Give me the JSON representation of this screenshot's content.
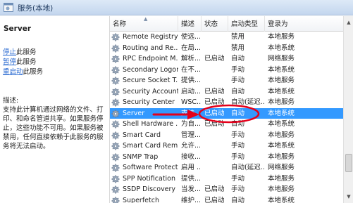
{
  "window": {
    "title": "服务(本地)"
  },
  "left_panel": {
    "heading": "Server",
    "actions": [
      {
        "link": "停止",
        "suffix": "此服务"
      },
      {
        "link": "暂停",
        "suffix": "此服务"
      },
      {
        "link": "重启动",
        "suffix": "此服务"
      }
    ],
    "description_label": "描述:",
    "description": "支持此计算机通过网络的文件、打印、和命名管道共享。如果服务停止，这些功能不可用。如果服务被禁用，任何直接依赖于此服务的服务将无法启动。"
  },
  "columns": [
    "名称",
    "描述",
    "状态",
    "启动类型",
    "登录为"
  ],
  "services": [
    {
      "name": "Remote Registry",
      "desc": "使远...",
      "status": "",
      "startup": "禁用",
      "logon": "本地服务"
    },
    {
      "name": "Routing and Re...",
      "desc": "在局...",
      "status": "",
      "startup": "禁用",
      "logon": "本地系统"
    },
    {
      "name": "RPC Endpoint M...",
      "desc": "解析...",
      "status": "已启动",
      "startup": "自动",
      "logon": "网络服务"
    },
    {
      "name": "Secondary Logon",
      "desc": "在不...",
      "status": "",
      "startup": "手动",
      "logon": "本地系统"
    },
    {
      "name": "Secure Socket T...",
      "desc": "提供...",
      "status": "",
      "startup": "手动",
      "logon": "本地服务"
    },
    {
      "name": "Security Account...",
      "desc": "启动...",
      "status": "已启动",
      "startup": "自动",
      "logon": "本地系统"
    },
    {
      "name": "Security Center",
      "desc": "WSC...",
      "status": "已启动",
      "startup": "自动(延迟...",
      "logon": "本地服务"
    },
    {
      "name": "Server",
      "desc": "支持...",
      "status": "已启动",
      "startup": "自动",
      "logon": "本地系统"
    },
    {
      "name": "Shell Hardware ...",
      "desc": "为自...",
      "status": "已启动",
      "startup": "自动",
      "logon": "本地系统"
    },
    {
      "name": "Smart Card",
      "desc": "管理...",
      "status": "",
      "startup": "手动",
      "logon": "本地服务"
    },
    {
      "name": "Smart Card Rem...",
      "desc": "允许...",
      "status": "",
      "startup": "手动",
      "logon": "本地系统"
    },
    {
      "name": "SNMP Trap",
      "desc": "接收...",
      "status": "",
      "startup": "手动",
      "logon": "本地服务"
    },
    {
      "name": "Software Protect...",
      "desc": "启用 ...",
      "status": "",
      "startup": "自动(延迟...",
      "logon": "网络服务"
    },
    {
      "name": "SPP Notification ...",
      "desc": "提供...",
      "status": "",
      "startup": "手动",
      "logon": "本地服务"
    },
    {
      "name": "SSDP Discovery",
      "desc": "当发...",
      "status": "已启动",
      "startup": "手动",
      "logon": "本地服务"
    },
    {
      "name": "Superfetch",
      "desc": "维护...",
      "status": "已启动",
      "startup": "自动",
      "logon": "本地系统"
    }
  ],
  "selected_index": 7,
  "colors": {
    "selection": "#3399ff",
    "annotation": "#e4001b",
    "link": "#2a6ad1"
  },
  "icons": {
    "service": "gear-icon",
    "title": "services-window-icon"
  }
}
